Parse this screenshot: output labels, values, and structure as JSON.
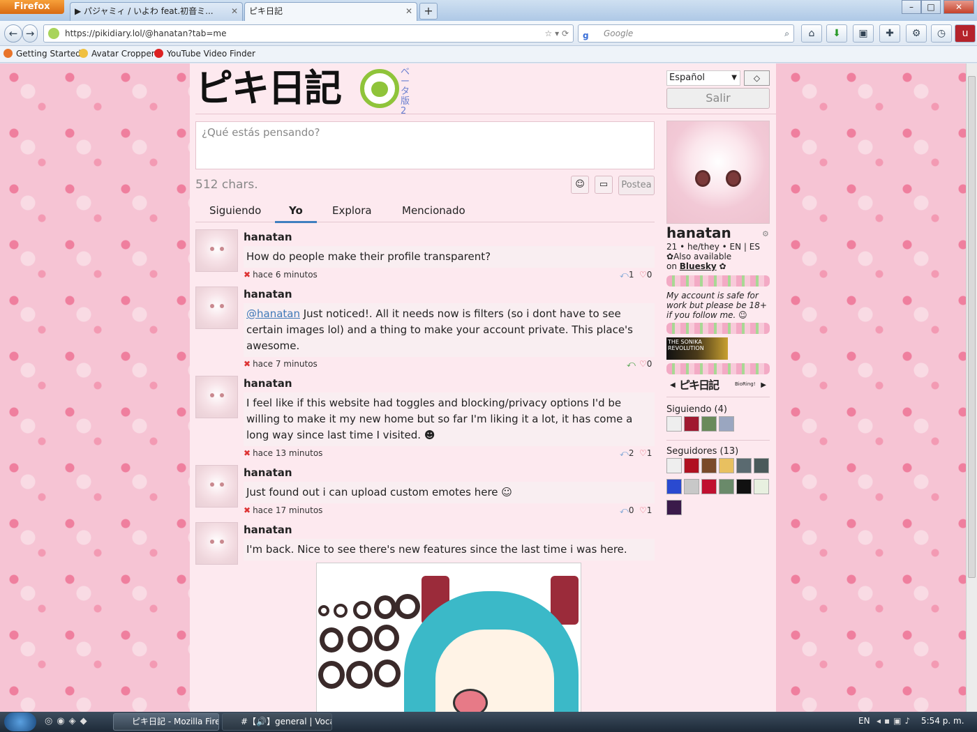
{
  "browser": {
    "app_button": "Firefox",
    "tabs": [
      {
        "label": "▶ パジャミィ / いよわ feat.初音ミ..."
      },
      {
        "label": "ピキ日記"
      }
    ],
    "url": "https://pikidiary.lol/@hanatan?tab=me",
    "search_placeholder": "Google",
    "bookmarks": [
      "Getting Started",
      "Avatar Cropper",
      "YouTube Video Finder"
    ]
  },
  "site": {
    "logo": "ピキ日記",
    "beta": "ベータ版2",
    "composer_placeholder": "¿Qué estás pensando?",
    "chars": "512 chars.",
    "post_button": "Postea",
    "tabs": [
      "Siguiendo",
      "Yo",
      "Explora",
      "Mencionado"
    ],
    "active_tab": "Yo"
  },
  "posts": [
    {
      "user": "hanatan",
      "body": "How do people make their profile transparent?",
      "time": "hace 6 minutos",
      "replies": "1",
      "likes": "0"
    },
    {
      "user": "hanatan",
      "mention": "@hanatan",
      "body": " Just noticed!. All it needs now is filters (so i dont have to see certain images lol) and a thing to make your account private. This place's awesome.",
      "time": "hace 7 minutos",
      "likes": "0"
    },
    {
      "user": "hanatan",
      "body": "I feel like if this website had toggles and blocking/privacy options I'd be willing to make it my new home but so far I'm liking it a lot, it has come a long way since last time I visited.",
      "time": "hace 13 minutos",
      "replies": "2",
      "likes": "1"
    },
    {
      "user": "hanatan",
      "body": "Just found out i can upload custom emotes here",
      "time": "hace 17 minutos",
      "replies": "0",
      "likes": "1"
    },
    {
      "user": "hanatan",
      "body": "I'm back. Nice to see there's new features since the last time i was here."
    }
  ],
  "sidebar": {
    "language": "Español",
    "language_button": "◇",
    "logout": "Salir",
    "username": "hanatan",
    "bio_line1": "21 • he/they • EN | ES",
    "bio_line2": "Also available",
    "bio_line3_prefix": "on ",
    "bio_link": "Bluesky",
    "safe_text": "My account is safe for work but please be 18+ if you follow me.",
    "sonika": "THE SONIKA REVOLUTION",
    "ring_label": "ピキ日記",
    "ring_small": "BioRing!",
    "following": "Siguiendo (4)",
    "followers": "Seguidores (13)"
  },
  "taskbar": {
    "items": [
      "ピキ日記 - Mozilla Fire...",
      "#【🔊】general | Vocaf..."
    ],
    "lang": "EN",
    "clock": "5:54 p. m."
  },
  "colors": {
    "accent_tab": "#3f7fbf",
    "logo_green": "#8fc43a",
    "page_bg": "#fde9ef"
  }
}
